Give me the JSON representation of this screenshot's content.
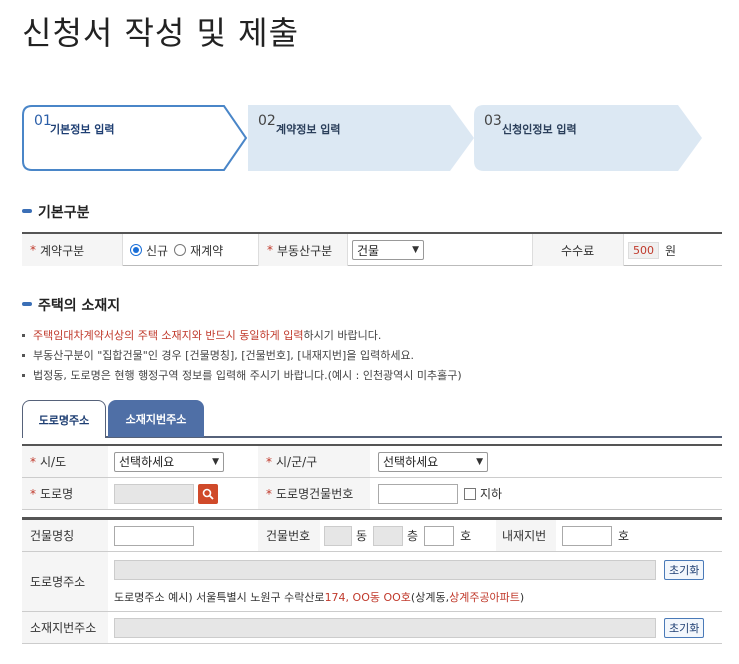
{
  "page_title": "신청서 작성 및 제출",
  "steps": [
    {
      "num": "01",
      "label": "기본정보 입력"
    },
    {
      "num": "02",
      "label": "계약정보 입력"
    },
    {
      "num": "03",
      "label": "신청인정보 입력"
    }
  ],
  "basic": {
    "title": "기본구분",
    "contract_type_label": "계약구분",
    "opt_new": "신규",
    "opt_renew": "재계약",
    "property_type_label": "부동산구분",
    "property_type_value": "건물",
    "fee_label": "수수료",
    "fee_value": "500",
    "fee_unit": "원"
  },
  "location": {
    "title": "주택의 소재지",
    "note1_red": "주택임대차계약서상의 주택 소재지와 반드시 동일하게 입력",
    "note1_rest": "하시기 바랍니다.",
    "note2": "부동산구분이 \"집합건물\"인 경우 [건물명칭], [건물번호], [내재지번]을 입력하세요.",
    "note3": "법정동, 도로명은 현행 행정구역 정보를 입력해 주시기 바랍니다.(예시 : 인천광역시 미추홀구)"
  },
  "tabs": {
    "road": "도로명주소",
    "lot": "소재지번주소"
  },
  "addr": {
    "sido_label": "시/도",
    "sido_value": "선택하세요",
    "sigungu_label": "시/군/구",
    "sigungu_value": "선택하세요",
    "road_label": "도로명",
    "bldg_no_label": "도로명건물번호",
    "basement": "지하",
    "bldg_name_label": "건물명칭",
    "bldg_num_label": "건물번호",
    "dong": "동",
    "floor": "층",
    "ho": "호",
    "inner_lot_label": "내재지번",
    "ho2": "호",
    "road_addr_label": "도로명주소",
    "reset1": "초기화",
    "example_prefix": "도로명주소 예시) 서울특별시 노원구 수락산로 ",
    "example_red1": "174, OO동 OO호",
    "example_mid": "(상계동, ",
    "example_red2": "상계주공아파트",
    "example_suffix": ")",
    "lot_addr_label": "소재지번주소",
    "reset2": "초기화"
  }
}
